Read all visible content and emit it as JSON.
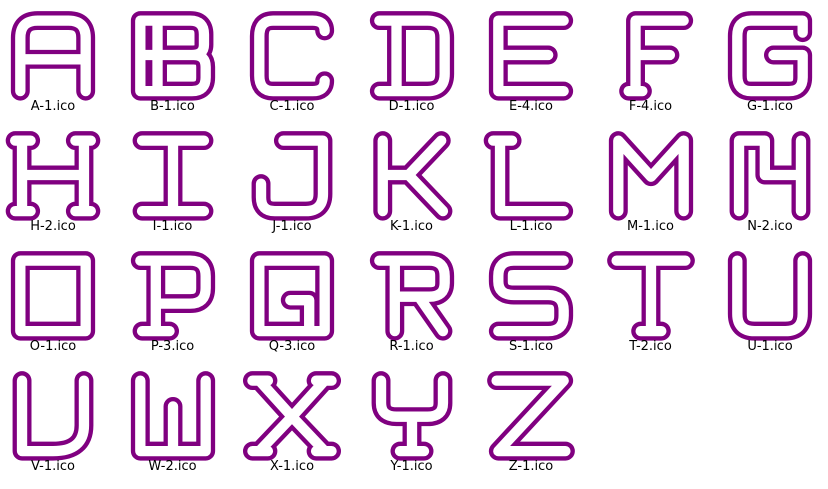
{
  "view": {
    "icon_color": "#800080",
    "background": "#ffffff",
    "label_color": "#000000"
  },
  "files": [
    {
      "letter": "A",
      "name": "A-1.ico"
    },
    {
      "letter": "B",
      "name": "B-1.ico"
    },
    {
      "letter": "C",
      "name": "C-1.ico"
    },
    {
      "letter": "D",
      "name": "D-1.ico"
    },
    {
      "letter": "E",
      "name": "E-4.ico"
    },
    {
      "letter": "F",
      "name": "F-4.ico"
    },
    {
      "letter": "G",
      "name": "G-1.ico"
    },
    {
      "letter": "H",
      "name": "H-2.ico"
    },
    {
      "letter": "I",
      "name": "I-1.ico"
    },
    {
      "letter": "J",
      "name": "J-1.ico"
    },
    {
      "letter": "K",
      "name": "K-1.ico"
    },
    {
      "letter": "L",
      "name": "L-1.ico"
    },
    {
      "letter": "M",
      "name": "M-1.ico"
    },
    {
      "letter": "N",
      "name": "N-2.ico"
    },
    {
      "letter": "O",
      "name": "O-1.ico"
    },
    {
      "letter": "P",
      "name": "P-3.ico"
    },
    {
      "letter": "Q",
      "name": "Q-3.ico"
    },
    {
      "letter": "R",
      "name": "R-1.ico"
    },
    {
      "letter": "S",
      "name": "S-1.ico"
    },
    {
      "letter": "T",
      "name": "T-2.ico"
    },
    {
      "letter": "U",
      "name": "U-1.ico"
    },
    {
      "letter": "V",
      "name": "V-1.ico"
    },
    {
      "letter": "W",
      "name": "W-2.ico"
    },
    {
      "letter": "X",
      "name": "X-1.ico"
    },
    {
      "letter": "Y",
      "name": "Y-1.ico"
    },
    {
      "letter": "Z",
      "name": "Z-1.ico"
    }
  ]
}
